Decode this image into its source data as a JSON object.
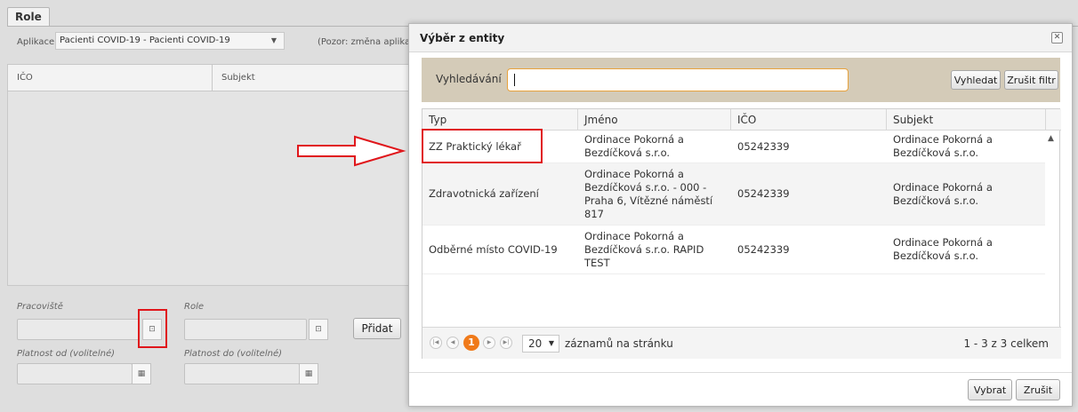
{
  "background": {
    "tab_label": "Role",
    "app_label": "Aplikace",
    "app_value": "Pacienti COVID-19 - Pacienti COVID-19",
    "note": "(Pozor: změna aplikac",
    "grid_headers": [
      "IČO",
      "Subjekt"
    ],
    "workplace_label": "Pracoviště",
    "role_label": "Role",
    "add_button": "Přidat",
    "valid_from_label": "Platnost od (volitelné)",
    "valid_to_label": "Platnost do (volitelné)"
  },
  "modal": {
    "title": "Výběr z entity",
    "search_label": "Vyhledávání",
    "search_value": "",
    "search_button": "Vyhledat",
    "clear_filter_button": "Zrušit filtr",
    "columns": [
      "Typ",
      "Jméno",
      "IČO",
      "Subjekt"
    ],
    "rows": [
      {
        "typ": "ZZ Praktický lékař",
        "jmeno": "Ordinace Pokorná a Bezdíčková s.r.o.",
        "ico": "05242339",
        "subjekt": "Ordinace Pokorná a Bezdíčková s.r.o."
      },
      {
        "typ": "Zdravotnická zařízení",
        "jmeno": "Ordinace Pokorná a Bezdíčková s.r.o. - 000 - Praha 6, Vítězné náměstí 817",
        "ico": "05242339",
        "subjekt": "Ordinace Pokorná a Bezdíčková s.r.o."
      },
      {
        "typ": "Odběrné místo COVID-19",
        "jmeno": "Ordinace Pokorná a Bezdíčková s.r.o. RAPID TEST",
        "ico": "05242339",
        "subjekt": "Ordinace Pokorná a Bezdíčková s.r.o."
      }
    ],
    "pager": {
      "current_page": "1",
      "page_size": "20",
      "per_page_text": "záznamů na stránku",
      "total_text": "1 - 3 z 3 celkem"
    },
    "select_button": "Vybrat",
    "cancel_button": "Zrušit"
  },
  "colors": {
    "highlight": "#e0161b",
    "search_bar": "#d4cbb8",
    "page_active": "#f07a1a"
  }
}
